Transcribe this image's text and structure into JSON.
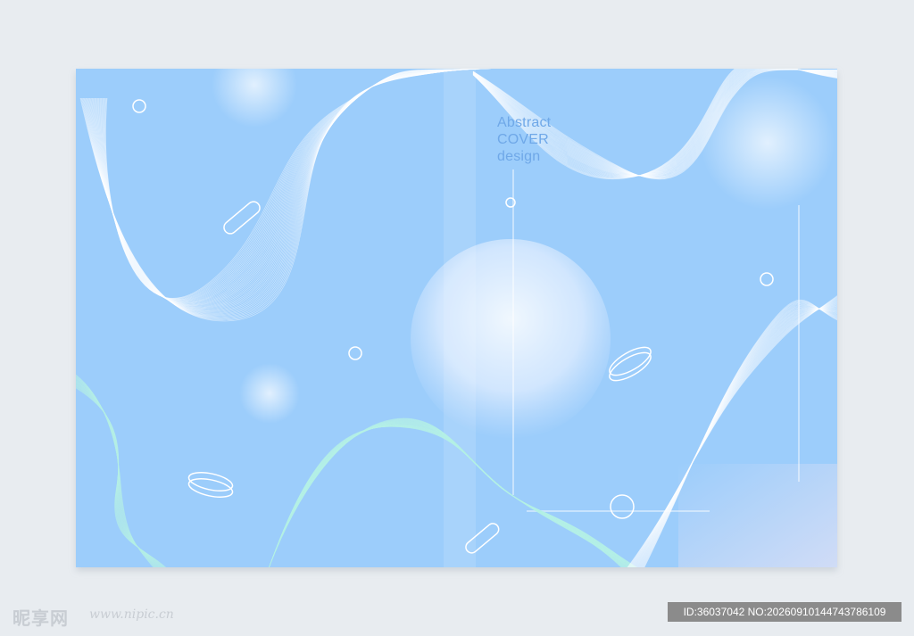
{
  "cover": {
    "title_lines": [
      "Abstract",
      "COVER",
      "design"
    ],
    "colors": {
      "background": "#e8ecf0",
      "cover_blue": "#9ccdfb",
      "title_blue": "#6fa8e8",
      "line_white": "#ffffff",
      "line_mint": "#b6f1e6"
    }
  },
  "watermark": {
    "site_logo": "昵享网",
    "url": "www.nipic.cn",
    "id_text": "ID:36037042 NO:20260910144743786109"
  }
}
